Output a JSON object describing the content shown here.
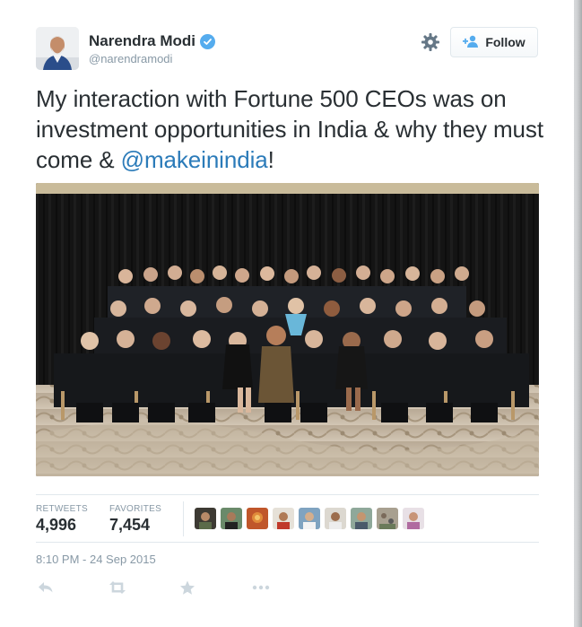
{
  "user": {
    "name": "Narendra Modi",
    "handle": "@narendramodi",
    "verified": true
  },
  "header": {
    "follow_label": "Follow",
    "settings_icon": "gear-icon",
    "follow_icon": "add-user-icon"
  },
  "tweet": {
    "text_before": "My interaction with Fortune 500 CEOs was on investment opportunities in India & why they must come & ",
    "mention": "@makeinindia",
    "text_after": "!"
  },
  "stats": {
    "retweets_label": "RETWEETS",
    "retweets_count": "4,996",
    "favorites_label": "FAVORITES",
    "favorites_count": "7,454",
    "favoriters_shown": 9
  },
  "timestamp": "8:10 PM - 24 Sep 2015",
  "actions": [
    {
      "name": "reply",
      "icon": "reply-icon"
    },
    {
      "name": "retweet",
      "icon": "retweet-icon"
    },
    {
      "name": "favorite",
      "icon": "star-icon"
    },
    {
      "name": "more",
      "icon": "more-icon"
    }
  ],
  "colors": {
    "link": "#2b7bb9",
    "verified": "#55acee",
    "muted": "#8899a6",
    "text": "#292f33"
  }
}
